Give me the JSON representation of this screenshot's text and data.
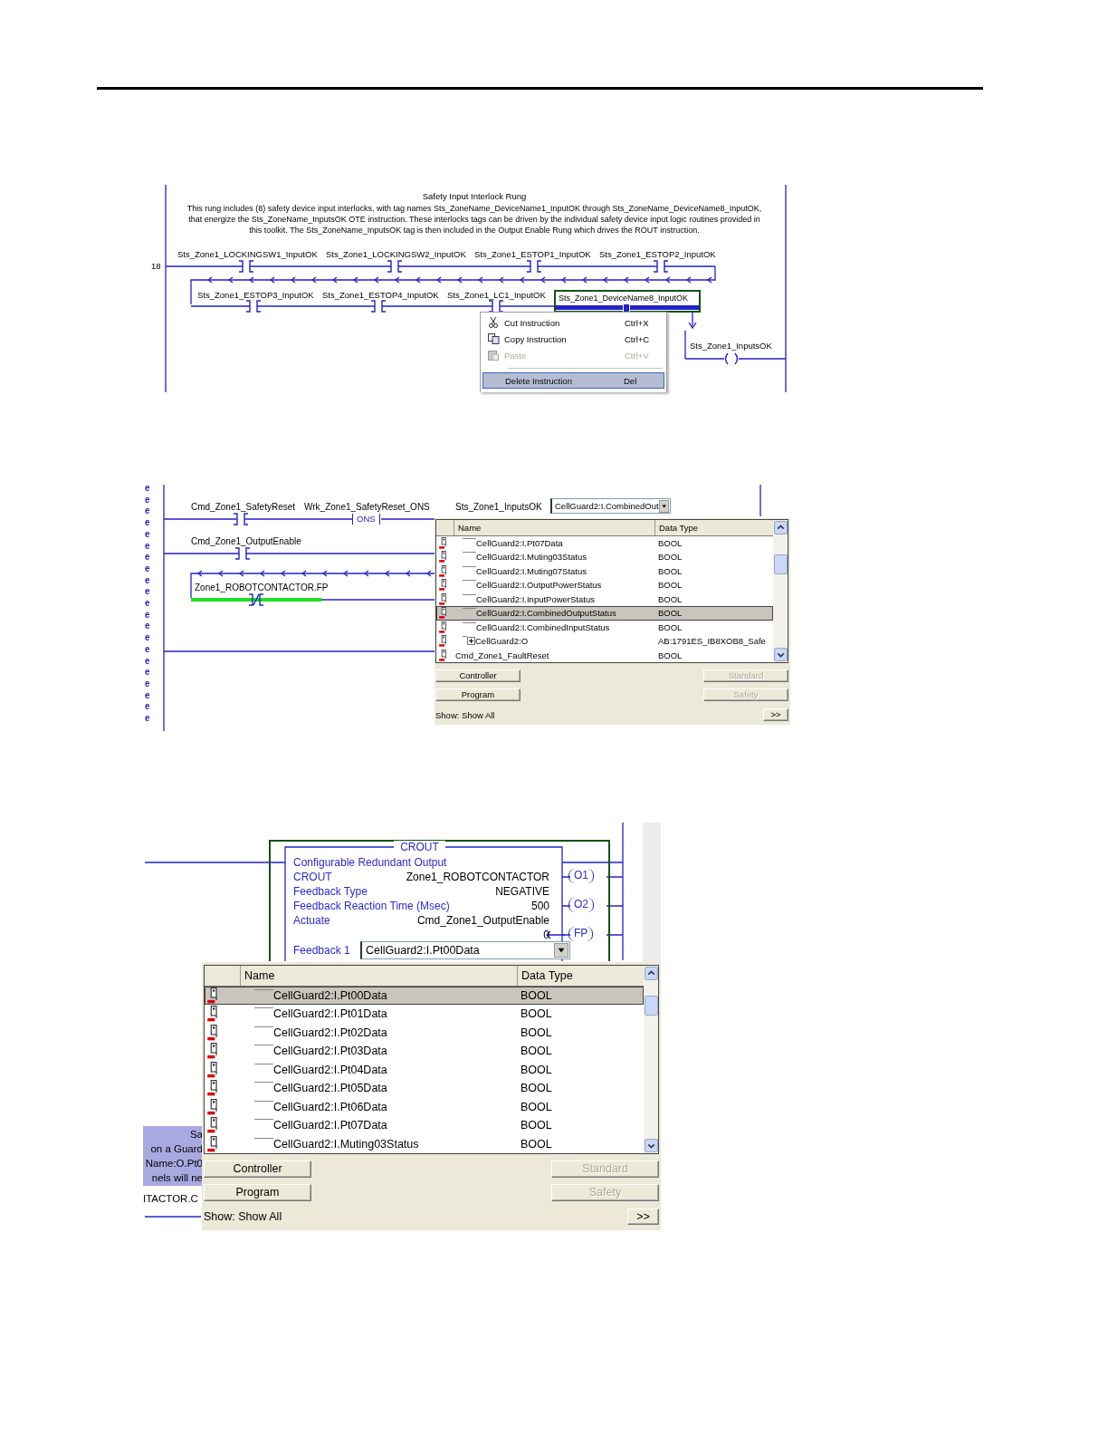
{
  "safety_rung": {
    "title": "Safety Input Interlock Rung",
    "comment": [
      "This rung includes (8) safety device input interlocks, with tag names Sts_ZoneName_DeviceName1_InputOK through Sts_ZoneName_DeviceName8_InputOK,",
      "that energize the Sts_ZoneName_InputsOK OTE instruction.  These interlocks tags can be driven by the individual safety device input logic routines provided in",
      "this toolkit.  The Sts_ZoneName_InputsOK tag is then included in the Output Enable Rung which drives the ROUT instruction."
    ],
    "rung_number": "18",
    "contacts": [
      {
        "tag": "Sts_Zone1_LOCKINGSW1_InputOK",
        "selected": false
      },
      {
        "tag": "Sts_Zone1_LOCKINGSW2_InputOK",
        "selected": false
      },
      {
        "tag": "Sts_Zone1_ESTOP1_InputOK",
        "selected": false
      },
      {
        "tag": "Sts_Zone1_ESTOP2_InputOK",
        "selected": false
      },
      {
        "tag": "Sts_Zone1_ESTOP3_InputOK",
        "selected": false
      },
      {
        "tag": "Sts_Zone1_ESTOP4_InputOK",
        "selected": false
      },
      {
        "tag": "Sts_Zone1_LC1_InputOK",
        "selected": false
      },
      {
        "tag": "Sts_Zone1_DeviceName8_InputOK",
        "selected": true
      }
    ],
    "coil": {
      "tag": "Sts_Zone1_InputsOK"
    },
    "context_menu": [
      {
        "kind": "command",
        "label": "Cut Instruction",
        "shortcut": "Ctrl+X",
        "disabled": false,
        "selected": false
      },
      {
        "kind": "command",
        "label": "Copy Instruction",
        "shortcut": "Ctrl+C",
        "disabled": false,
        "selected": false
      },
      {
        "kind": "command",
        "label": "Paste",
        "shortcut": "Ctrl+V",
        "disabled": true,
        "selected": false
      },
      {
        "kind": "separator"
      },
      {
        "kind": "command",
        "label": "Delete Instruction",
        "shortcut": "Del",
        "disabled": false,
        "selected": true
      }
    ]
  },
  "output_enable_rung": {
    "margin_marks": [
      "e",
      "e",
      "e",
      "e",
      "e",
      "e",
      "e",
      "e",
      "e",
      "e",
      "e",
      "e",
      "e",
      "e",
      "e",
      "e",
      "e",
      "e",
      "e",
      "e",
      "e"
    ],
    "contacts": [
      {
        "tag": "Cmd_Zone1_SafetyReset",
        "kind": "xic",
        "energized": false
      },
      {
        "tag": "Cmd_Zone1_OutputEnable",
        "kind": "xic",
        "energized": false
      },
      {
        "tag": "Zone1_ROBOTCONTACTOR.FP",
        "kind": "xio",
        "energized": true
      }
    ],
    "ons": {
      "tag": "Wrk_Zone1_SafetyReset_ONS",
      "label": "ONS"
    },
    "edit_tag": {
      "tag": "Sts_Zone1_InputsOK",
      "value": "CellGuard2:I.CombinedOut"
    },
    "browser": {
      "columns": [
        "Name",
        "Data Type"
      ],
      "rows": [
        {
          "kind": "tag",
          "name": "CellGuard2:I.Pt07Data",
          "type": "BOOL",
          "selected": false
        },
        {
          "kind": "tag",
          "name": "CellGuard2:I.Muting03Status",
          "type": "BOOL",
          "selected": false
        },
        {
          "kind": "tag",
          "name": "CellGuard2:I.Muting07Status",
          "type": "BOOL",
          "selected": false
        },
        {
          "kind": "tag",
          "name": "CellGuard2:I.OutputPowerStatus",
          "type": "BOOL",
          "selected": false
        },
        {
          "kind": "tag",
          "name": "CellGuard2:I.InputPowerStatus",
          "type": "BOOL",
          "selected": false
        },
        {
          "kind": "tag",
          "name": "CellGuard2:I.CombinedOutputStatus",
          "type": "BOOL",
          "selected": true
        },
        {
          "kind": "tag",
          "name": "CellGuard2:I.CombinedInputStatus",
          "type": "BOOL",
          "selected": false
        },
        {
          "kind": "module",
          "name": "CellGuard2:O",
          "type": "AB:1791ES_IB8XOB8_Safe",
          "selected": false
        },
        {
          "kind": "root",
          "name": "Cmd_Zone1_FaultReset",
          "type": "BOOL",
          "selected": false
        }
      ],
      "buttons": [
        {
          "label": "Controller",
          "disabled": false
        },
        {
          "label": "Standard",
          "disabled": true
        },
        {
          "label": "Program",
          "disabled": false
        },
        {
          "label": "Safety",
          "disabled": true
        }
      ],
      "show": "Show: Show All",
      "more": ">>"
    }
  },
  "crout_rung": {
    "instruction": "CROUT",
    "description": "Configurable Redundant Output",
    "params": [
      {
        "label": "CROUT",
        "value": "Zone1_ROBOTCONTACTOR"
      },
      {
        "label": "Feedback Type",
        "value": "NEGATIVE"
      },
      {
        "label": "Feedback Reaction Time (Msec)",
        "value": "500"
      },
      {
        "label": "Actuate",
        "value": "Cmd_Zone1_OutputEnable"
      }
    ],
    "fp_value": "0",
    "feedback": {
      "label": "Feedback 1",
      "value": "CellGuard2:I.Pt00Data"
    },
    "outputs": [
      "O1",
      "O2",
      "FP"
    ],
    "background_text": [
      "Sa",
      "on a Guard",
      "Name:O.Pt0",
      "nels will ne"
    ],
    "background_tag": "ITACTOR.C",
    "browser": {
      "columns": [
        "Name",
        "Data Type"
      ],
      "rows": [
        {
          "kind": "tag",
          "name": "CellGuard2:I.Pt00Data",
          "type": "BOOL",
          "selected": true
        },
        {
          "kind": "tag",
          "name": "CellGuard2:I.Pt01Data",
          "type": "BOOL",
          "selected": false
        },
        {
          "kind": "tag",
          "name": "CellGuard2:I.Pt02Data",
          "type": "BOOL",
          "selected": false
        },
        {
          "kind": "tag",
          "name": "CellGuard2:I.Pt03Data",
          "type": "BOOL",
          "selected": false
        },
        {
          "kind": "tag",
          "name": "CellGuard2:I.Pt04Data",
          "type": "BOOL",
          "selected": false
        },
        {
          "kind": "tag",
          "name": "CellGuard2:I.Pt05Data",
          "type": "BOOL",
          "selected": false
        },
        {
          "kind": "tag",
          "name": "CellGuard2:I.Pt06Data",
          "type": "BOOL",
          "selected": false
        },
        {
          "kind": "tag",
          "name": "CellGuard2:I.Pt07Data",
          "type": "BOOL",
          "selected": false
        },
        {
          "kind": "tag",
          "name": "CellGuard2:I.Muting03Status",
          "type": "BOOL",
          "selected": false
        }
      ],
      "buttons": [
        {
          "label": "Controller",
          "disabled": false
        },
        {
          "label": "Standard",
          "disabled": true
        },
        {
          "label": "Program",
          "disabled": false
        },
        {
          "label": "Safety",
          "disabled": true
        }
      ],
      "show": "Show: Show All",
      "more": ">>"
    }
  }
}
